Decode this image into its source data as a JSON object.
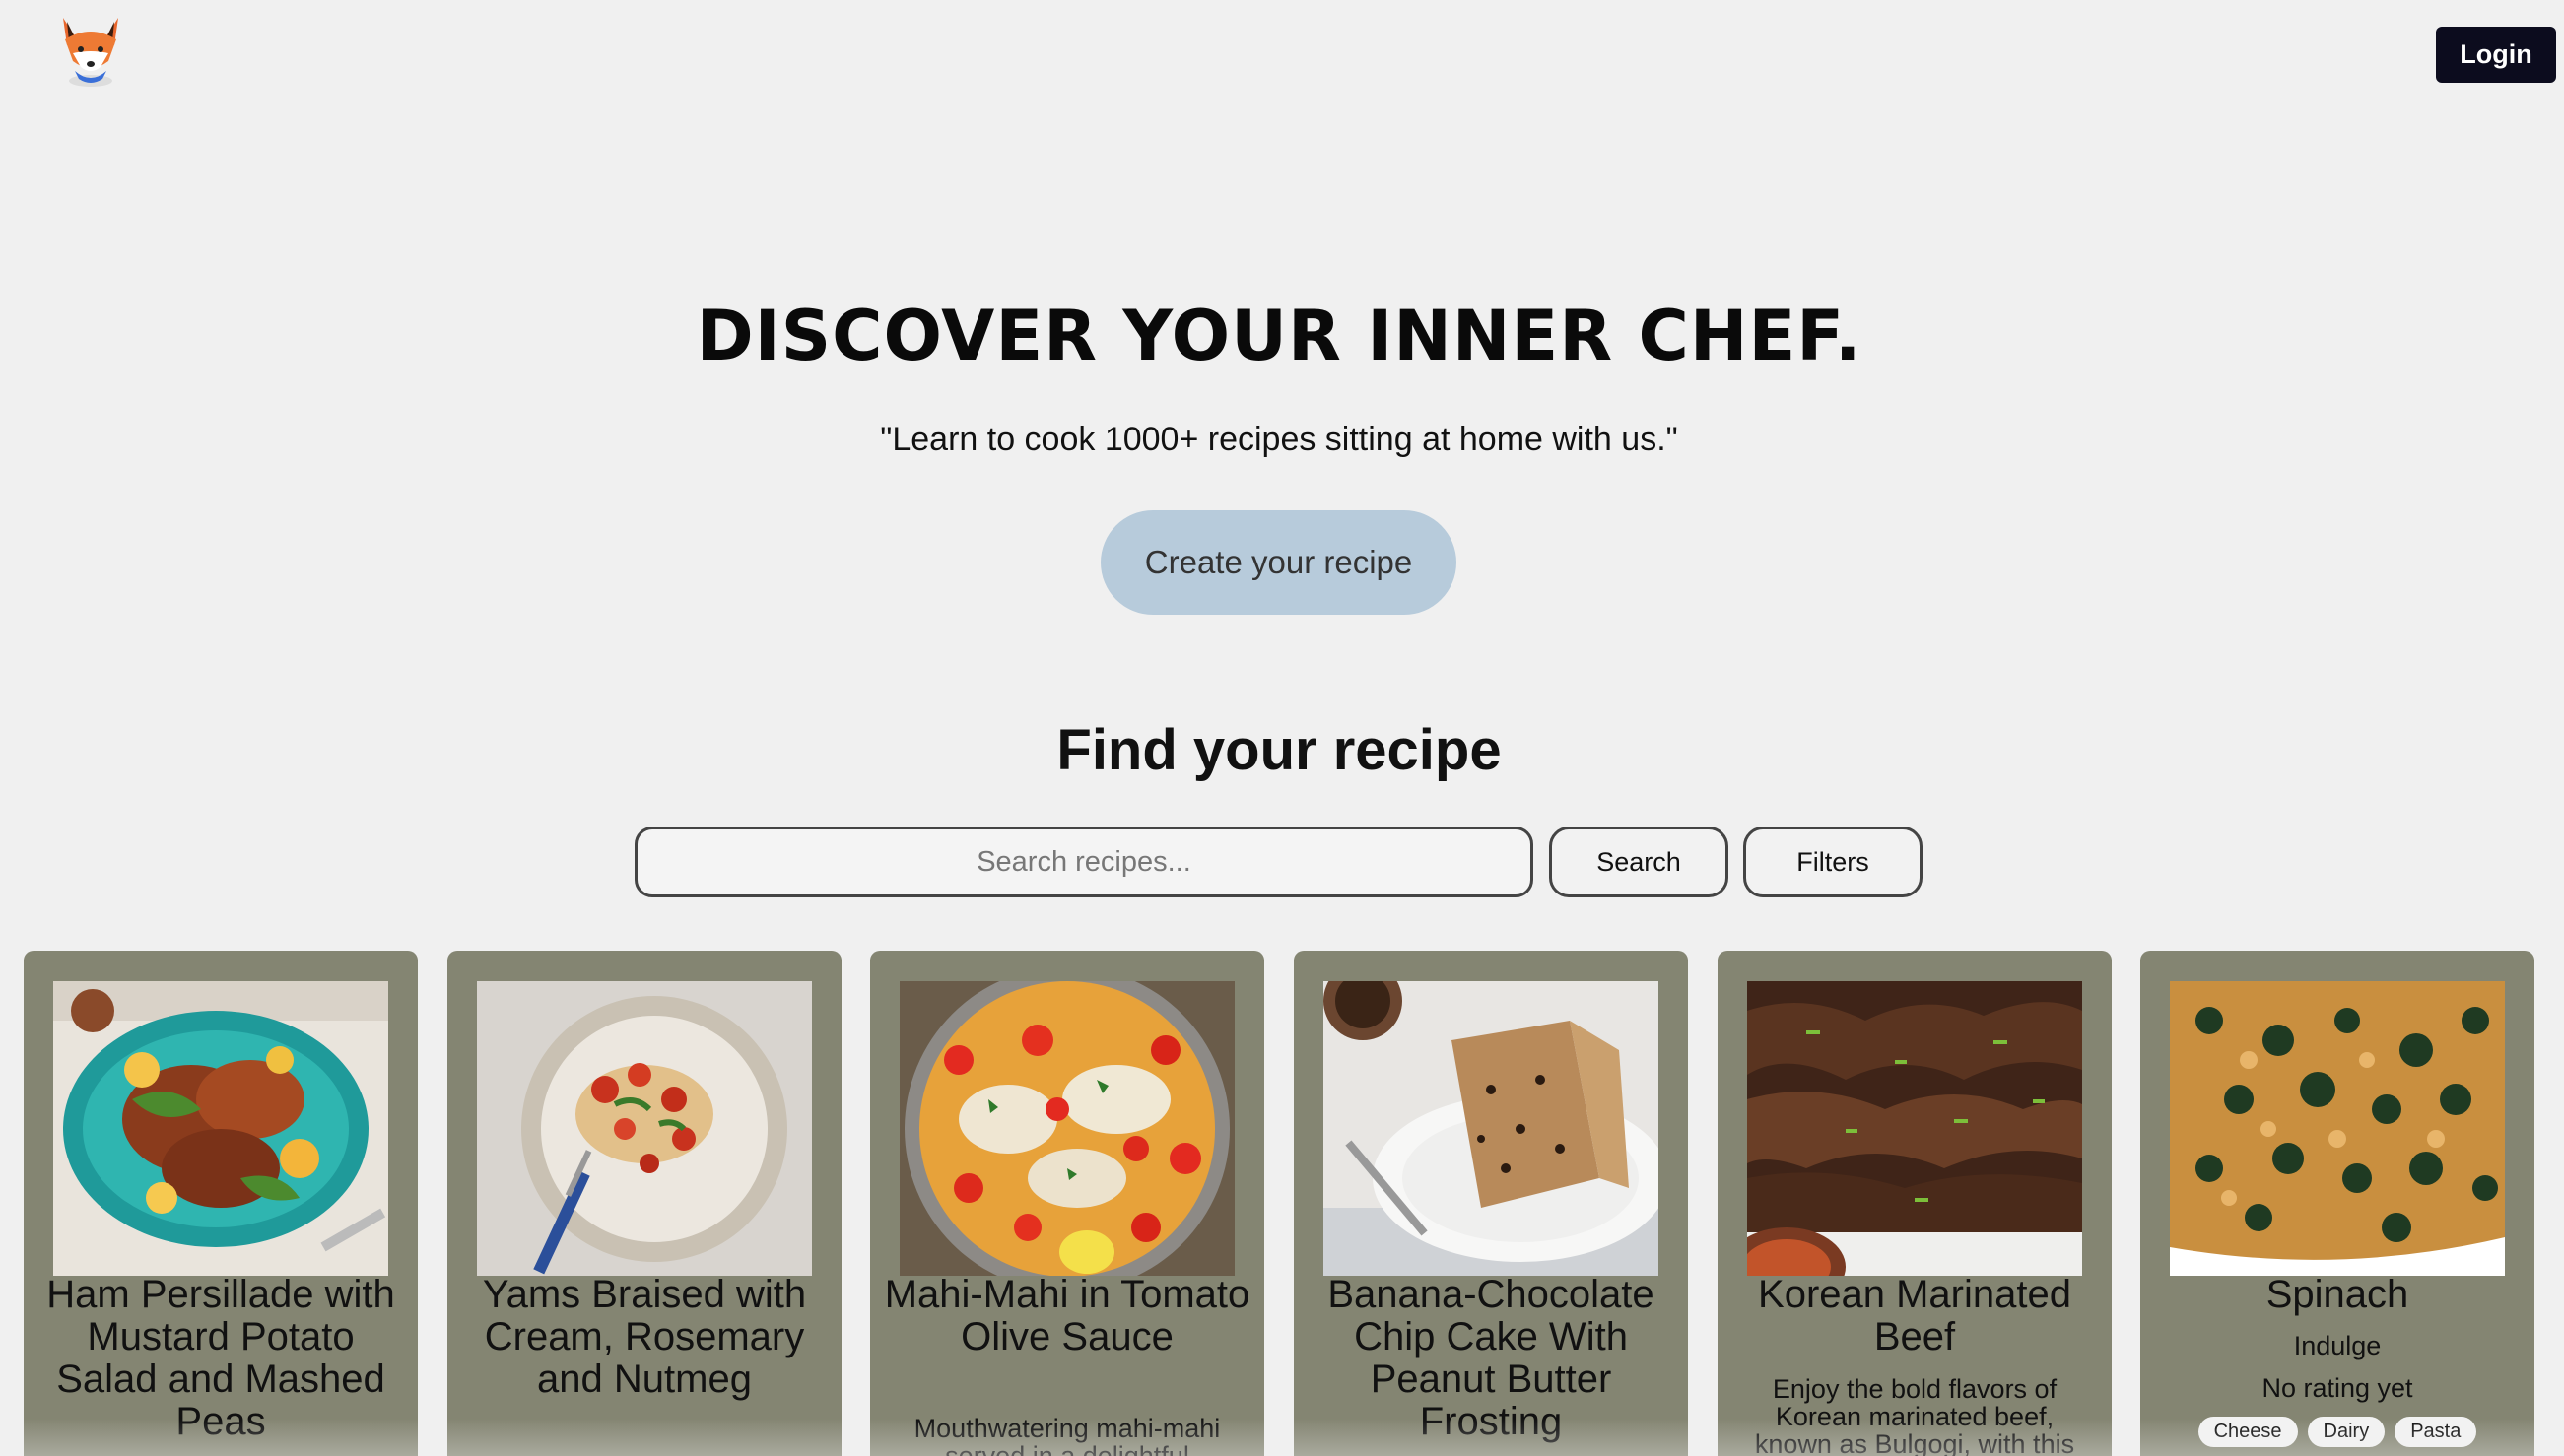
{
  "header": {
    "logo_icon": "fox-logo-icon",
    "login_label": "Login"
  },
  "hero": {
    "title": "DISCOVER YOUR INNER CHEF.",
    "subtitle": "\"Learn to cook 1000+ recipes sitting at home with us.\"",
    "create_label": "Create your recipe"
  },
  "search": {
    "title": "Find your recipe",
    "placeholder": "Search recipes...",
    "search_label": "Search",
    "filters_label": "Filters"
  },
  "recipes": [
    {
      "title": "Ham Persillade with Mustard Potato Salad and Mashed Peas",
      "image": "ham-dish-image"
    },
    {
      "title": "Yams Braised with Cream, Rosemary and Nutmeg",
      "image": "yams-dish-image"
    },
    {
      "title": "Mahi-Mahi in Tomato Olive Sauce",
      "description": "Mouthwatering mahi-mahi served in a delightful",
      "image": "mahi-mahi-dish-image"
    },
    {
      "title": "Banana-Chocolate Chip Cake With Peanut Butter Frosting",
      "image": "cake-image"
    },
    {
      "title": "Korean Marinated Beef",
      "description": "Enjoy the bold flavors of Korean marinated beef, known as Bulgogi, with this",
      "image": "beef-dish-image"
    },
    {
      "title": "Spinach",
      "category": "Indulge",
      "rating": "No rating yet",
      "tags": [
        "Cheese",
        "Dairy",
        "Pasta"
      ],
      "image": "spinach-pasta-image"
    }
  ],
  "colors": {
    "background": "#f0f0f0",
    "login_bg": "#0c0c1e",
    "create_btn": "#b7cbdb",
    "card_bg": "#848572"
  }
}
